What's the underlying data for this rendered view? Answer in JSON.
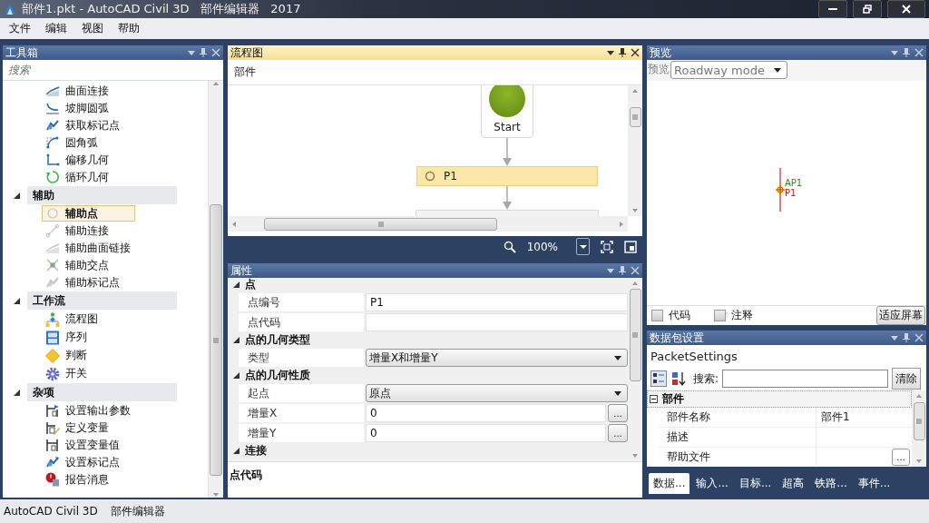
{
  "window": {
    "title": "部件1.pkt - AutoCAD Civil 3D   部件编辑器   2017"
  },
  "menu": [
    "文件",
    "编辑",
    "视图",
    "帮助"
  ],
  "toolbox": {
    "title": "工具箱",
    "search": {
      "placeholder": "搜索"
    },
    "tree": [
      {
        "label": "曲面连接",
        "selected": false
      },
      {
        "label": "坡脚圆弧",
        "selected": false
      },
      {
        "label": "获取标记点",
        "selected": false
      },
      {
        "label": "圆角弧",
        "selected": false
      },
      {
        "label": "偏移几何",
        "selected": false
      },
      {
        "label": "循环几何",
        "selected": false
      },
      {
        "label": "辅助",
        "expanded": true,
        "children": [
          {
            "label": "辅助点",
            "selected": true
          },
          {
            "label": "辅助连接",
            "selected": false
          },
          {
            "label": "辅助曲面链接",
            "selected": false
          },
          {
            "label": "辅助交点",
            "selected": false
          },
          {
            "label": "辅助标记点",
            "selected": false
          }
        ]
      },
      {
        "label": "工作流",
        "expanded": true,
        "children": [
          {
            "label": "流程图",
            "selected": false
          },
          {
            "label": "序列",
            "selected": false
          },
          {
            "label": "判断",
            "selected": false
          },
          {
            "label": "开关",
            "selected": false
          }
        ]
      },
      {
        "label": "杂项",
        "expanded": true,
        "children": [
          {
            "label": "设置输出参数",
            "selected": false
          },
          {
            "label": "定义变量",
            "selected": false
          },
          {
            "label": "设置变量值",
            "selected": false
          },
          {
            "label": "设置标记点",
            "selected": false
          },
          {
            "label": "报告消息",
            "selected": false
          }
        ]
      }
    ]
  },
  "flowchart": {
    "title": "流程图",
    "breadcrumb": "部件",
    "zoom": "100%",
    "nodes": [
      {
        "kind": "start",
        "label": "Start",
        "selected": false
      },
      {
        "kind": "point",
        "label": "P1",
        "selected": true
      },
      {
        "kind": "step",
        "selected": false
      }
    ]
  },
  "properties": {
    "title": "属性",
    "sections": [
      {
        "label": "点",
        "expanded": true,
        "rows": [
          {
            "name": "点编号",
            "kind": "text",
            "value": "P1"
          },
          {
            "name": "点代码",
            "kind": "text"
          }
        ]
      },
      {
        "label": "点的几何类型",
        "expanded": true,
        "rows": [
          {
            "name": "类型",
            "kind": "dropdown",
            "value": "增量X和增量Y"
          }
        ]
      },
      {
        "label": "点的几何性质",
        "expanded": true,
        "rows": [
          {
            "name": "起点",
            "kind": "dropdown",
            "value": "原点"
          },
          {
            "name": "增量X",
            "kind": "text_button",
            "value": "0",
            "button": "..."
          },
          {
            "name": "增量Y",
            "kind": "text_button",
            "value": "0",
            "button": "..."
          }
        ]
      },
      {
        "label": "连接",
        "expanded": true
      }
    ],
    "description": "点代码"
  },
  "preview": {
    "title": "预览",
    "label": "预览",
    "mode": "Roadway mode",
    "labels": [
      "AP1",
      "P1"
    ],
    "checkboxes": [
      {
        "label": "代码",
        "checked": false
      },
      {
        "label": "注释",
        "checked": false
      }
    ],
    "button": "适应屏幕"
  },
  "packet": {
    "title": "数据包设置",
    "name": "PacketSettings",
    "search_label": "搜索:",
    "clear": "清除",
    "category": {
      "label": "部件",
      "expanded": true,
      "rows": [
        {
          "name": "部件名称",
          "value": "部件1"
        },
        {
          "name": "描述"
        },
        {
          "name": "帮助文件",
          "button": "..."
        }
      ]
    },
    "tabs": [
      {
        "label": "数据...",
        "selected": true
      },
      {
        "label": "输入...",
        "selected": false
      },
      {
        "label": "目标...",
        "selected": false
      },
      {
        "label": "超高",
        "selected": false
      },
      {
        "label": "铁路...",
        "selected": false
      },
      {
        "label": "事件...",
        "selected": false
      }
    ]
  },
  "status_bar": [
    "AutoCAD Civil 3D",
    "部件编辑器"
  ]
}
